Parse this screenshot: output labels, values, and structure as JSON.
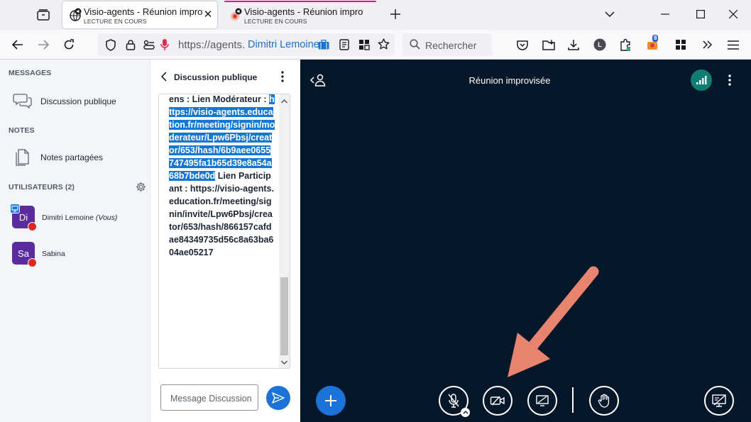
{
  "browser": {
    "tabs": [
      {
        "title": "Visio-agents - Réunion improvis",
        "subtitle": "LECTURE EN COURS"
      },
      {
        "title": "Visio-agents - Réunion improvis",
        "subtitle": "LECTURE EN COURS"
      }
    ],
    "url": "https://agents.",
    "url_overlay_name": "Dimitri Lemoine",
    "search_placeholder": "Rechercher",
    "extension_badge": "8",
    "profile_letter": "L"
  },
  "sidebar": {
    "messages_heading": "MESSAGES",
    "public_chat_label": "Discussion publique",
    "notes_heading": "NOTES",
    "shared_notes_label": "Notes partagées",
    "users_heading": "UTILISATEURS (2)",
    "users": [
      {
        "initials": "Di",
        "name": "Dimitri Lemoine",
        "suffix": "(Vous)"
      },
      {
        "initials": "Sa",
        "name": "Sabina",
        "suffix": ""
      }
    ]
  },
  "chat": {
    "title": "Discussion publique",
    "text_before": "envoyés via l'un de ces liens : Lien Modérateur : ",
    "link_highlighted": "https://visio-agents.education.fr/meeting/signin/moderateur/Lpw6Pbsj/creator/653/hash/6b9aee0655747495fa1b65d39e8a54a68b7bde0d",
    "text_after": " Lien Participant : https://visio-agents.education.fr/meeting/signin/invite/Lpw6Pbsj/creator/653/hash/866157cafdae84349735d56c8a63ba604ae05217",
    "input_placeholder": "Message Discussion"
  },
  "main": {
    "title": "Réunion improvisée"
  },
  "colors": {
    "main_bg": "#06172a",
    "accent_blue": "#1b73d8",
    "highlight": "#1677d2",
    "avatar": "#5b2ca0",
    "mic_off": "#df2721",
    "connection": "#0f7d74",
    "annotation_arrow": "#e8836f"
  }
}
